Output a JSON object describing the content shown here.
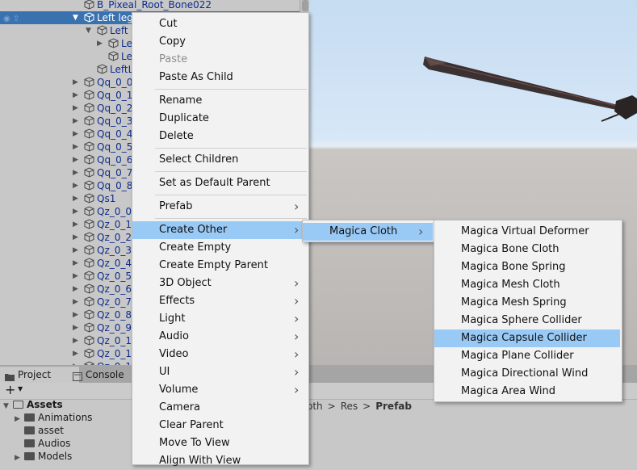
{
  "hierarchy": {
    "rows": [
      {
        "label": "B_Pixeal_Root_Bone022",
        "indent": 104,
        "arrow": "",
        "cube": true
      },
      {
        "label": "Left leg",
        "indent": 104,
        "arrow": "▼",
        "cube": true,
        "selected": true
      },
      {
        "label": "Left l",
        "indent": 120,
        "arrow": "▼",
        "cube": true
      },
      {
        "label": "Le",
        "indent": 134,
        "arrow": "▶",
        "cube": true
      },
      {
        "label": "Le",
        "indent": 134,
        "arrow": "",
        "cube": true
      },
      {
        "label": "LeftL",
        "indent": 120,
        "arrow": "",
        "cube": true
      },
      {
        "label": "Qq_0_0",
        "indent": 104,
        "arrow": "▶",
        "cube": true
      },
      {
        "label": "Qq_0_1",
        "indent": 104,
        "arrow": "▶",
        "cube": true
      },
      {
        "label": "Qq_0_2",
        "indent": 104,
        "arrow": "▶",
        "cube": true
      },
      {
        "label": "Qq_0_3",
        "indent": 104,
        "arrow": "▶",
        "cube": true
      },
      {
        "label": "Qq_0_4",
        "indent": 104,
        "arrow": "▶",
        "cube": true
      },
      {
        "label": "Qq_0_5",
        "indent": 104,
        "arrow": "▶",
        "cube": true
      },
      {
        "label": "Qq_0_6",
        "indent": 104,
        "arrow": "▶",
        "cube": true
      },
      {
        "label": "Qq_0_7",
        "indent": 104,
        "arrow": "▶",
        "cube": true
      },
      {
        "label": "Qq_0_8",
        "indent": 104,
        "arrow": "▶",
        "cube": true
      },
      {
        "label": "Qs1",
        "indent": 104,
        "arrow": "▶",
        "cube": true
      },
      {
        "label": "Qz_0_0",
        "indent": 104,
        "arrow": "▶",
        "cube": true
      },
      {
        "label": "Qz_0_1",
        "indent": 104,
        "arrow": "▶",
        "cube": true
      },
      {
        "label": "Qz_0_2",
        "indent": 104,
        "arrow": "▶",
        "cube": true
      },
      {
        "label": "Qz_0_3",
        "indent": 104,
        "arrow": "▶",
        "cube": true
      },
      {
        "label": "Qz_0_4",
        "indent": 104,
        "arrow": "▶",
        "cube": true
      },
      {
        "label": "Qz_0_5",
        "indent": 104,
        "arrow": "▶",
        "cube": true
      },
      {
        "label": "Qz_0_6",
        "indent": 104,
        "arrow": "▶",
        "cube": true
      },
      {
        "label": "Qz_0_7",
        "indent": 104,
        "arrow": "▶",
        "cube": true
      },
      {
        "label": "Qz_0_8",
        "indent": 104,
        "arrow": "▶",
        "cube": true
      },
      {
        "label": "Qz_0_9",
        "indent": 104,
        "arrow": "▶",
        "cube": true
      },
      {
        "label": "Qz_0_10",
        "indent": 104,
        "arrow": "▶",
        "cube": true
      },
      {
        "label": "Qz_0_11",
        "indent": 104,
        "arrow": "▶",
        "cube": true
      },
      {
        "label": "Qz_0_12",
        "indent": 104,
        "arrow": "▶",
        "cube": true
      }
    ]
  },
  "context_menu": {
    "items": [
      {
        "label": "Cut",
        "type": "item"
      },
      {
        "label": "Copy",
        "type": "item"
      },
      {
        "label": "Paste",
        "type": "item",
        "disabled": true
      },
      {
        "label": "Paste As Child",
        "type": "item"
      },
      {
        "type": "separator"
      },
      {
        "label": "Rename",
        "type": "item"
      },
      {
        "label": "Duplicate",
        "type": "item"
      },
      {
        "label": "Delete",
        "type": "item"
      },
      {
        "type": "separator"
      },
      {
        "label": "Select Children",
        "type": "item"
      },
      {
        "type": "separator"
      },
      {
        "label": "Set as Default Parent",
        "type": "item"
      },
      {
        "type": "separator"
      },
      {
        "label": "Prefab",
        "type": "item",
        "submenu": true
      },
      {
        "type": "separator"
      },
      {
        "label": "Create Other",
        "type": "item",
        "submenu": true,
        "highlight": true
      },
      {
        "label": "Create Empty",
        "type": "item"
      },
      {
        "label": "Create Empty Parent",
        "type": "item"
      },
      {
        "label": "3D Object",
        "type": "item",
        "submenu": true
      },
      {
        "label": "Effects",
        "type": "item",
        "submenu": true
      },
      {
        "label": "Light",
        "type": "item",
        "submenu": true
      },
      {
        "label": "Audio",
        "type": "item",
        "submenu": true
      },
      {
        "label": "Video",
        "type": "item",
        "submenu": true
      },
      {
        "label": "UI",
        "type": "item",
        "submenu": true
      },
      {
        "label": "Volume",
        "type": "item",
        "submenu": true
      },
      {
        "label": "Camera",
        "type": "item"
      },
      {
        "label": "Clear Parent",
        "type": "item"
      },
      {
        "label": "Move To View",
        "type": "item"
      },
      {
        "label": "Align With View",
        "type": "item"
      }
    ]
  },
  "submenu_create_other": {
    "items": [
      {
        "label": "Magica Cloth",
        "submenu": true,
        "highlight": true
      }
    ]
  },
  "submenu_magica_cloth": {
    "items": [
      {
        "label": "Magica Virtual Deformer"
      },
      {
        "label": "Magica Bone Cloth"
      },
      {
        "label": "Magica Bone Spring"
      },
      {
        "label": "Magica Mesh Cloth"
      },
      {
        "label": "Magica Mesh Spring"
      },
      {
        "label": "Magica Sphere Collider"
      },
      {
        "label": "Magica Capsule Collider",
        "highlight": true
      },
      {
        "label": "Magica Plane Collider"
      },
      {
        "label": "Magica Directional Wind"
      },
      {
        "label": "Magica Area Wind"
      }
    ]
  },
  "bottom_panel": {
    "tabs": [
      {
        "label": "Project",
        "active": true,
        "icon": "folder-icon"
      },
      {
        "label": "Console",
        "active": false,
        "icon": "console-icon"
      }
    ],
    "add_label": "+",
    "tree": [
      {
        "label": "Assets",
        "level": 0,
        "arrow": "▼",
        "bold": true,
        "open": true
      },
      {
        "label": "Animations",
        "level": 1,
        "arrow": "▶"
      },
      {
        "label": "asset",
        "level": 1,
        "arrow": ""
      },
      {
        "label": "Audios",
        "level": 1,
        "arrow": ""
      },
      {
        "label": "Models",
        "level": 1,
        "arrow": "▶"
      }
    ],
    "breadcrumb": {
      "items": [
        "oth",
        "Res",
        "Prefab"
      ],
      "separator": ">"
    }
  },
  "colors": {
    "selection": "#3a72b0",
    "menu_highlight": "#99c9f5",
    "hierarchy_text": "#0c2c8c"
  }
}
